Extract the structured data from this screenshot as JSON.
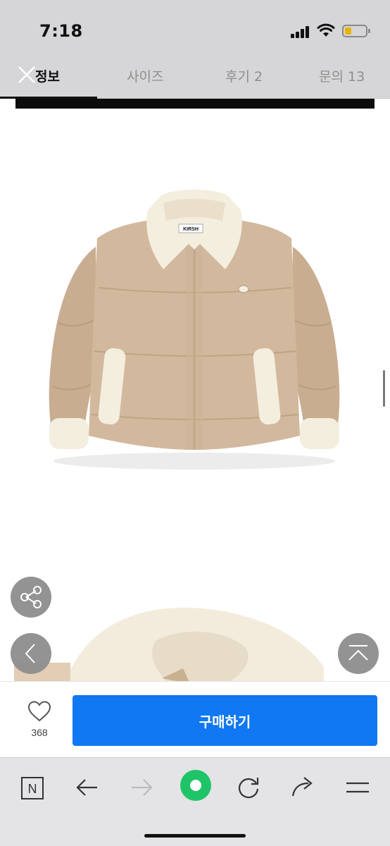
{
  "status_bar": {
    "time": "7:18"
  },
  "tabs": [
    {
      "label": "정보",
      "active": true
    },
    {
      "label": "사이즈",
      "active": false
    },
    {
      "label": "후기 2",
      "active": false
    },
    {
      "label": "문의 13",
      "active": false
    }
  ],
  "product": {
    "brand_label": "KIRSH"
  },
  "purchase": {
    "like_count": "368",
    "buy_label": "구매하기"
  },
  "icons": {
    "close": "close-icon",
    "share": "share-icon",
    "prev": "chevron-left-icon",
    "scroll_top": "scroll-top-icon",
    "heart": "heart-icon",
    "naver": "naver-n-icon",
    "back": "arrow-left-icon",
    "forward": "arrow-right-icon",
    "green_dot": "green-circle-icon",
    "refresh": "refresh-icon",
    "share_browser": "share-arrow-icon",
    "menu": "menu-icon"
  },
  "colors": {
    "buy_button": "#0f78f2",
    "header_bg": "#d6d6d8",
    "jacket": "#d2b89d",
    "sherpa": "#f4eedf",
    "green": "#1fc468"
  }
}
